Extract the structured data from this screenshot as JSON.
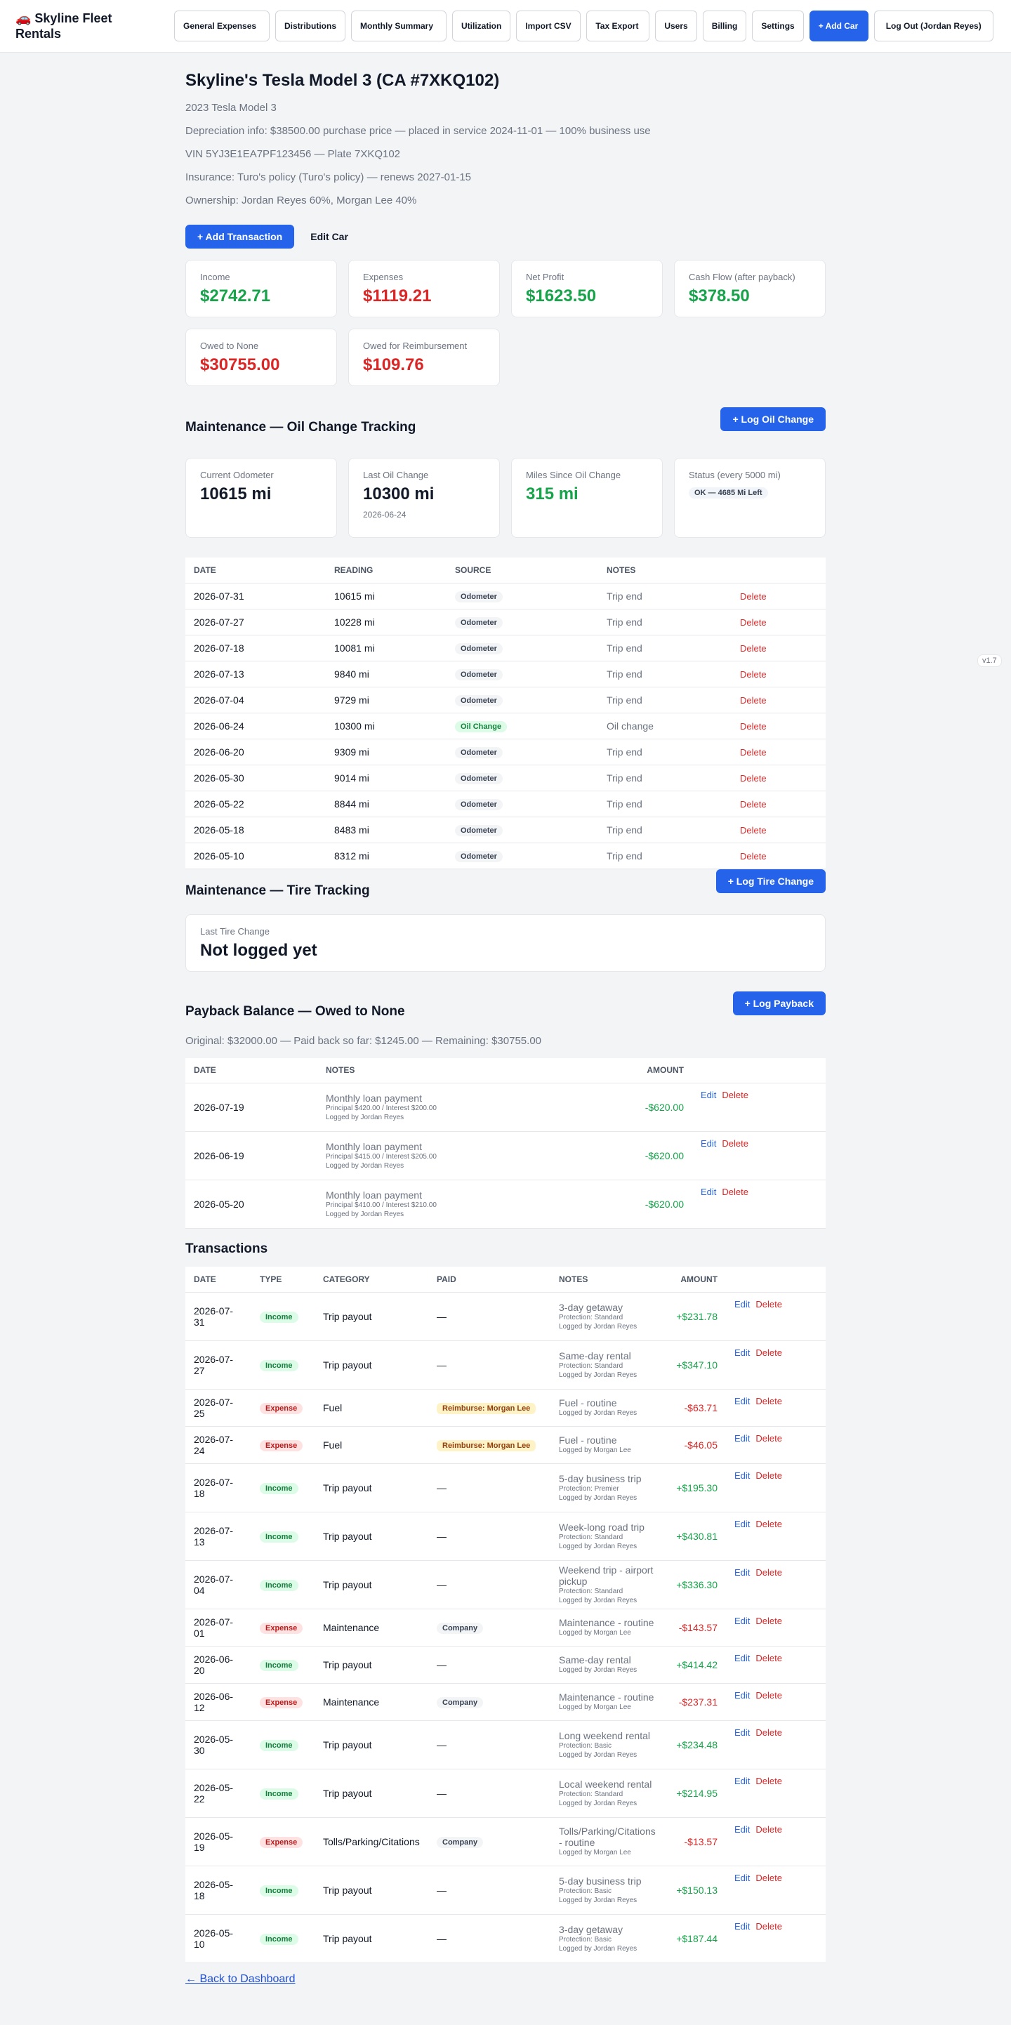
{
  "nav": {
    "brand": "🚗 Skyline Fleet Rentals",
    "items": [
      "General Expenses",
      "Distributions",
      "Monthly Summary",
      "Utilization",
      "Import CSV",
      "Tax Export",
      "Users",
      "Billing",
      "Settings"
    ],
    "add_car": "+ Add Car",
    "logout": "Log Out (Jordan Reyes)",
    "version": "v1.7"
  },
  "car": {
    "title": "Skyline's Tesla Model 3 (CA #7XKQ102)",
    "model": "2023 Tesla Model 3",
    "depreciation": "Depreciation info: $38500.00 purchase price — placed in service 2024-11-01 — 100% business use",
    "vin": "VIN 5YJ3E1EA7PF123456 — Plate 7XKQ102",
    "insurance": "Insurance: Turo's policy (Turo's policy) — renews 2027-01-15",
    "ownership": "Ownership: Jordan Reyes 60%, Morgan Lee 40%",
    "add_transaction": "+ Add Transaction",
    "edit_car": "Edit Car"
  },
  "summary": [
    {
      "label": "Income",
      "value": "$2742.71",
      "color": "green"
    },
    {
      "label": "Expenses",
      "value": "$1119.21",
      "color": "red"
    },
    {
      "label": "Net Profit",
      "value": "$1623.50",
      "color": "green"
    },
    {
      "label": "Cash Flow (after payback)",
      "value": "$378.50",
      "color": "green"
    },
    {
      "label": "Owed to None",
      "value": "$30755.00",
      "color": "red"
    },
    {
      "label": "Owed for Reimbursement",
      "value": "$109.76",
      "color": "red"
    }
  ],
  "oil": {
    "title": "Maintenance — Oil Change Tracking",
    "button": "+ Log Oil Change",
    "cards": {
      "odometer_label": "Current Odometer",
      "odometer_value": "10615 mi",
      "last_label": "Last Oil Change",
      "last_value": "10300 mi",
      "last_date": "2026-06-24",
      "since_label": "Miles Since Oil Change",
      "since_value": "315 mi",
      "status_label": "Status (every 5000 mi)",
      "status_value": "OK — 4685 Mi Left"
    },
    "headers": [
      "DATE",
      "READING",
      "SOURCE",
      "NOTES"
    ],
    "delete": "Delete",
    "rows": [
      {
        "date": "2026-07-31",
        "reading": "10615 mi",
        "source": "Odometer",
        "notes": "Trip end"
      },
      {
        "date": "2026-07-27",
        "reading": "10228 mi",
        "source": "Odometer",
        "notes": "Trip end"
      },
      {
        "date": "2026-07-18",
        "reading": "10081 mi",
        "source": "Odometer",
        "notes": "Trip end"
      },
      {
        "date": "2026-07-13",
        "reading": "9840 mi",
        "source": "Odometer",
        "notes": "Trip end"
      },
      {
        "date": "2026-07-04",
        "reading": "9729 mi",
        "source": "Odometer",
        "notes": "Trip end"
      },
      {
        "date": "2026-06-24",
        "reading": "10300 mi",
        "source": "Oil Change",
        "notes": "Oil change"
      },
      {
        "date": "2026-06-20",
        "reading": "9309 mi",
        "source": "Odometer",
        "notes": "Trip end"
      },
      {
        "date": "2026-05-30",
        "reading": "9014 mi",
        "source": "Odometer",
        "notes": "Trip end"
      },
      {
        "date": "2026-05-22",
        "reading": "8844 mi",
        "source": "Odometer",
        "notes": "Trip end"
      },
      {
        "date": "2026-05-18",
        "reading": "8483 mi",
        "source": "Odometer",
        "notes": "Trip end"
      },
      {
        "date": "2026-05-10",
        "reading": "8312 mi",
        "source": "Odometer",
        "notes": "Trip end"
      }
    ]
  },
  "tire": {
    "title": "Maintenance — Tire Tracking",
    "button": "+ Log Tire Change",
    "card_label": "Last Tire Change",
    "card_value": "Not logged yet"
  },
  "payback": {
    "title": "Payback Balance — Owed to None",
    "button": "+ Log Payback",
    "summary": "Original: $32000.00 — Paid back so far: $1245.00 — Remaining: $30755.00",
    "headers": [
      "DATE",
      "NOTES",
      "AMOUNT"
    ],
    "edit": "Edit",
    "delete": "Delete",
    "rows": [
      {
        "date": "2026-07-19",
        "note": "Monthly loan payment",
        "detail": "Principal $420.00 / Interest $200.00",
        "logged": "Logged by Jordan Reyes",
        "amount": "-$620.00"
      },
      {
        "date": "2026-06-19",
        "note": "Monthly loan payment",
        "detail": "Principal $415.00 / Interest $205.00",
        "logged": "Logged by Jordan Reyes",
        "amount": "-$620.00"
      },
      {
        "date": "2026-05-20",
        "note": "Monthly loan payment",
        "detail": "Principal $410.00 / Interest $210.00",
        "logged": "Logged by Jordan Reyes",
        "amount": "-$620.00"
      }
    ]
  },
  "transactions": {
    "title": "Transactions",
    "headers": [
      "DATE",
      "TYPE",
      "CATEGORY",
      "PAID",
      "NOTES",
      "AMOUNT"
    ],
    "edit": "Edit",
    "delete": "Delete",
    "rows": [
      {
        "date": "2026-07-31",
        "type": "Income",
        "category": "Trip payout",
        "paid": "—",
        "note": "3-day getaway",
        "protection": "Protection: Standard",
        "logged": "Logged by Jordan Reyes",
        "amount": "+$231.78"
      },
      {
        "date": "2026-07-27",
        "type": "Income",
        "category": "Trip payout",
        "paid": "—",
        "note": "Same-day rental",
        "protection": "Protection: Standard",
        "logged": "Logged by Jordan Reyes",
        "amount": "+$347.10"
      },
      {
        "date": "2026-07-25",
        "type": "Expense",
        "category": "Fuel",
        "paid": "Reimburse: Morgan Lee",
        "note": "Fuel - routine",
        "protection": "",
        "logged": "Logged by Jordan Reyes",
        "amount": "-$63.71"
      },
      {
        "date": "2026-07-24",
        "type": "Expense",
        "category": "Fuel",
        "paid": "Reimburse: Morgan Lee",
        "note": "Fuel - routine",
        "protection": "",
        "logged": "Logged by Morgan Lee",
        "amount": "-$46.05"
      },
      {
        "date": "2026-07-18",
        "type": "Income",
        "category": "Trip payout",
        "paid": "—",
        "note": "5-day business trip",
        "protection": "Protection: Premier",
        "logged": "Logged by Jordan Reyes",
        "amount": "+$195.30"
      },
      {
        "date": "2026-07-13",
        "type": "Income",
        "category": "Trip payout",
        "paid": "—",
        "note": "Week-long road trip",
        "protection": "Protection: Standard",
        "logged": "Logged by Jordan Reyes",
        "amount": "+$430.81"
      },
      {
        "date": "2026-07-04",
        "type": "Income",
        "category": "Trip payout",
        "paid": "—",
        "note": "Weekend trip - airport pickup",
        "protection": "Protection: Standard",
        "logged": "Logged by Jordan Reyes",
        "amount": "+$336.30"
      },
      {
        "date": "2026-07-01",
        "type": "Expense",
        "category": "Maintenance",
        "paid": "Company",
        "note": "Maintenance - routine",
        "protection": "",
        "logged": "Logged by Morgan Lee",
        "amount": "-$143.57"
      },
      {
        "date": "2026-06-20",
        "type": "Income",
        "category": "Trip payout",
        "paid": "—",
        "note": "Same-day rental",
        "protection": "",
        "logged": "Logged by Jordan Reyes",
        "amount": "+$414.42"
      },
      {
        "date": "2026-06-12",
        "type": "Expense",
        "category": "Maintenance",
        "paid": "Company",
        "note": "Maintenance - routine",
        "protection": "",
        "logged": "Logged by Morgan Lee",
        "amount": "-$237.31"
      },
      {
        "date": "2026-05-30",
        "type": "Income",
        "category": "Trip payout",
        "paid": "—",
        "note": "Long weekend rental",
        "protection": "Protection: Basic",
        "logged": "Logged by Jordan Reyes",
        "amount": "+$234.48"
      },
      {
        "date": "2026-05-22",
        "type": "Income",
        "category": "Trip payout",
        "paid": "—",
        "note": "Local weekend rental",
        "protection": "Protection: Standard",
        "logged": "Logged by Jordan Reyes",
        "amount": "+$214.95"
      },
      {
        "date": "2026-05-19",
        "type": "Expense",
        "category": "Tolls/Parking/Citations",
        "paid": "Company",
        "note": "Tolls/Parking/Citations - routine",
        "protection": "",
        "logged": "Logged by Morgan Lee",
        "amount": "-$13.57"
      },
      {
        "date": "2026-05-18",
        "type": "Income",
        "category": "Trip payout",
        "paid": "—",
        "note": "5-day business trip",
        "protection": "Protection: Basic",
        "logged": "Logged by Jordan Reyes",
        "amount": "+$150.13"
      },
      {
        "date": "2026-05-10",
        "type": "Income",
        "category": "Trip payout",
        "paid": "—",
        "note": "3-day getaway",
        "protection": "Protection: Basic",
        "logged": "Logged by Jordan Reyes",
        "amount": "+$187.44"
      }
    ]
  },
  "back_link": "← Back to Dashboard",
  "colors": {
    "primary": "#2563eb",
    "income": "#16a34a",
    "expense": "#dc2626"
  }
}
